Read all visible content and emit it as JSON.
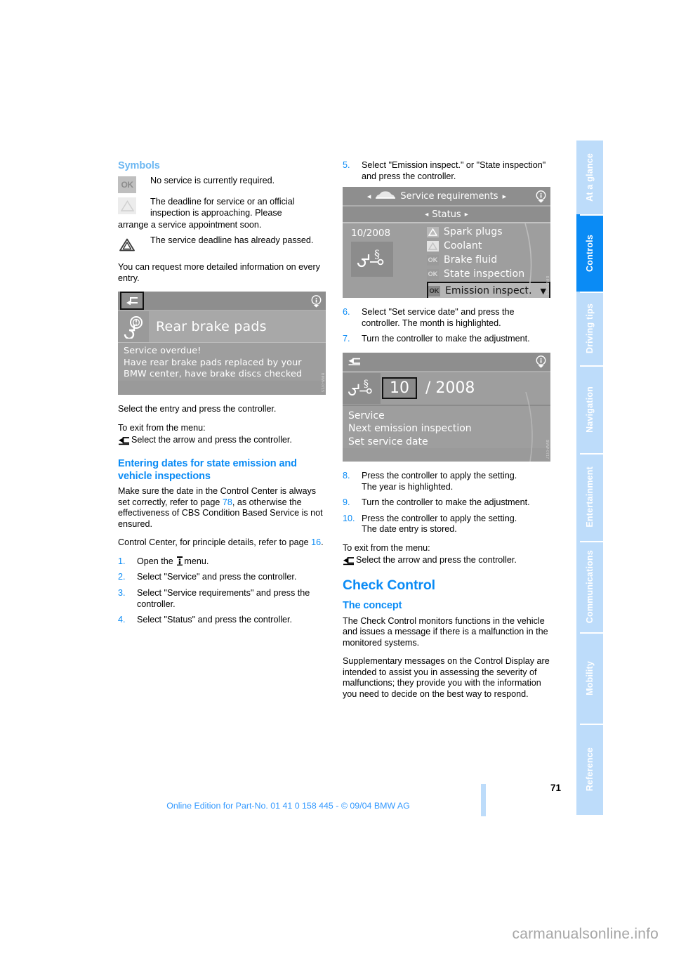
{
  "document": {
    "page_number": "71",
    "edition_line": "Online Edition for Part-No. 01 41 0 158 445 - © 09/04 BMW AG",
    "watermark": "carmanualsonline.info"
  },
  "sidebar": {
    "tabs": [
      {
        "label": "At a glance",
        "active": false
      },
      {
        "label": "Controls",
        "active": true
      },
      {
        "label": "Driving tips",
        "active": false
      },
      {
        "label": "Navigation",
        "active": false
      },
      {
        "label": "Entertainment",
        "active": false
      },
      {
        "label": "Communications",
        "active": false
      },
      {
        "label": "Mobility",
        "active": false
      },
      {
        "label": "Reference",
        "active": false
      }
    ],
    "active_color": "#0a8bf5",
    "inactive_color": "#bddcfa"
  },
  "left_column": {
    "symbols_heading": "Symbols",
    "symbols": [
      {
        "icon": "ok-badge-icon",
        "text": "No service is currently required."
      },
      {
        "icon": "warning-triangle-light-icon",
        "text": "The deadline for service or an official inspection is approaching. Please",
        "continuation": "arrange a service appointment soon."
      },
      {
        "icon": "warning-triangle-dark-icon",
        "text": "The service deadline has already passed."
      }
    ],
    "detail_paragraph": "You can request more detailed information on every entry.",
    "after_shot_paragraph": "Select the entry and press the controller.",
    "exit_menu_label": "To exit from the menu:",
    "exit_menu_instruction": "Select the arrow and press the controller.",
    "entering_dates_heading": "Entering dates for state emission and vehicle inspections",
    "make_sure_text_part1": "Make sure the date in the Control Center is always set correctly, refer to page ",
    "make_sure_page_ref": "78",
    "make_sure_text_part2": ", as otherwise the effectiveness of CBS Condition Based Service is not ensured.",
    "control_center_text_part1": "Control Center, for principle details, refer to page ",
    "control_center_page_ref": "16",
    "control_center_text_part2": ".",
    "steps": [
      {
        "num": "1.",
        "text_before_icon": "Open the ",
        "icon": "info-i-icon",
        "text_after_icon": "menu."
      },
      {
        "num": "2.",
        "text": "Select \"Service\" and press the controller."
      },
      {
        "num": "3.",
        "text": "Select \"Service requirements\" and press the controller."
      },
      {
        "num": "4.",
        "text": "Select \"Status\" and press the controller."
      }
    ]
  },
  "right_column": {
    "steps_top": [
      {
        "num": "5.",
        "text": "Select \"Emission inspect.\" or \"State inspection\" and press the controller."
      }
    ],
    "steps_mid": [
      {
        "num": "6.",
        "text": "Select \"Set service date\" and press the controller. The month is highlighted."
      },
      {
        "num": "7.",
        "text": "Turn the controller to make the adjustment."
      }
    ],
    "steps_bottom": [
      {
        "num": "8.",
        "text": "Press the controller to apply the setting.",
        "sub": "The year is highlighted."
      },
      {
        "num": "9.",
        "text": "Turn the controller to make the adjustment."
      },
      {
        "num": "10.",
        "text": "Press the controller to apply the setting.",
        "sub": "The date entry is stored."
      }
    ],
    "exit_menu_label": "To exit from the menu:",
    "exit_menu_instruction": "Select the arrow and press the controller.",
    "check_control_heading": "Check Control",
    "the_concept_heading": "The concept",
    "concept_p1": "The Check Control monitors functions in the vehicle and issues a message if there is a malfunction in the monitored systems.",
    "concept_p2": "Supplementary messages on the Control Display are intended to assist you in assessing the severity of malfunctions; they provide you with the information you need to decide on the best way to respond."
  },
  "display_shots": {
    "brake_pads": {
      "back_icon": "back-arrow-icon",
      "info_icon": "info-circle-icon",
      "entry_icon": "brake-pad-icon",
      "entry_label": "Rear brake pads",
      "message_lines": [
        "Service overdue!",
        "Have rear brake pads replaced by your",
        "BMW center, have brake discs checked"
      ]
    },
    "service_requirements": {
      "car_icon": "car-icon",
      "title": "Service requirements",
      "info_icon": "info-circle-icon",
      "subtitle": "Status",
      "date": "10/2008",
      "big_icon": "inspection-stamp-icon",
      "items": [
        {
          "badge": "warn",
          "label": "Spark plugs",
          "selected": false
        },
        {
          "badge": "warn2",
          "label": "Coolant",
          "selected": false
        },
        {
          "badge": "ok",
          "label": "Brake fluid",
          "selected": false
        },
        {
          "badge": "ok",
          "label": "State inspection",
          "selected": false
        },
        {
          "badge": "ok-dk",
          "label": "Emission inspect.",
          "selected": true
        }
      ],
      "badge_ok_text": "OK",
      "scroll_down_icon": "chevron-down-icon"
    },
    "set_service_date": {
      "back_icon": "back-arrow-icon",
      "info_icon": "info-circle-icon",
      "big_icon": "inspection-stamp-icon",
      "month": "10",
      "separator": "/",
      "year": "2008",
      "lines": [
        "Service",
        "Next emission inspection",
        "Set service date"
      ]
    }
  }
}
